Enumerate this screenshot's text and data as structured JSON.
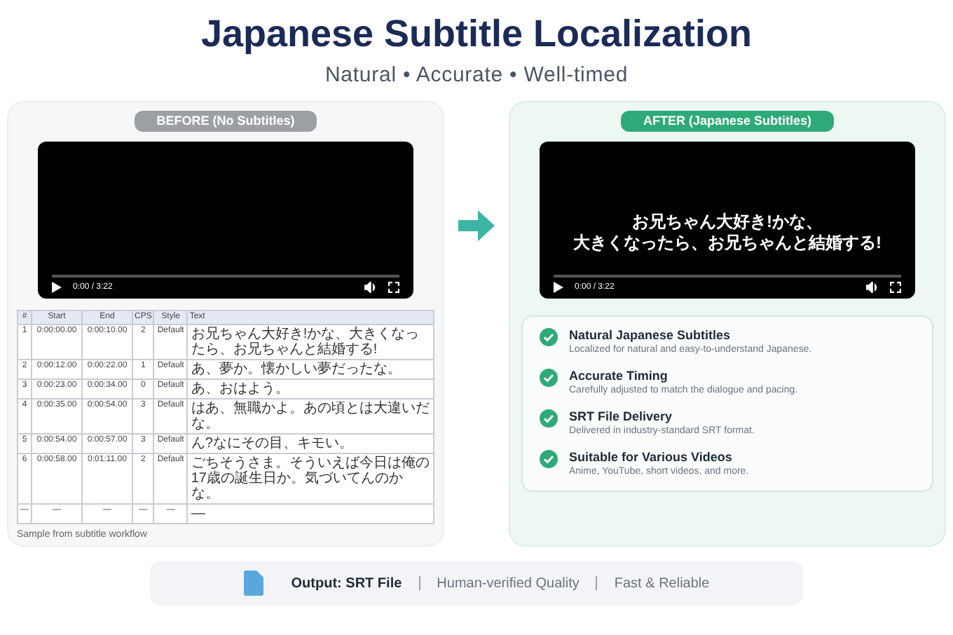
{
  "title": "Japanese Subtitle Localization",
  "subtitle": "Natural • Accurate • Well-timed",
  "before": {
    "label": "BEFORE (No Subtitles)",
    "video": {
      "time": "0:00 / 3:22"
    },
    "table": {
      "columns": [
        "#",
        "Start",
        "End",
        "CPS",
        "Style",
        "Text"
      ],
      "rows": [
        [
          "1",
          "0:00:00.00",
          "0:00:10.00",
          "2",
          "Default",
          "お兄ちゃん大好き!かな、大きくなったら、お兄ちゃんと結婚する!"
        ],
        [
          "2",
          "0:00:12.00",
          "0:00:22.00",
          "1",
          "Default",
          "あ、夢か。懐かしい夢だったな。"
        ],
        [
          "3",
          "0:00:23.00",
          "0:00:34.00",
          "0",
          "Default",
          "あ、おはよう。"
        ],
        [
          "4",
          "0:00:35.00",
          "0:00:54.00",
          "3",
          "Default",
          "はあ、無職かよ。あの頃とは大違いだな。"
        ],
        [
          "5",
          "0:00:54.00",
          "0:00:57.00",
          "3",
          "Default",
          "ん?なにその目、キモい。"
        ],
        [
          "6",
          "0:00:58.00",
          "0:01:11.00",
          "2",
          "Default",
          "ごちそうさま。そういえば今日は俺の17歳の誕生日か。気づいてんのかな。"
        ],
        [
          "—",
          "—",
          "—",
          "—",
          "—",
          "—"
        ]
      ]
    },
    "caption": "Sample from subtitle workflow"
  },
  "after": {
    "label": "AFTER (Japanese Subtitles)",
    "video": {
      "time": "0:00 / 3:22",
      "subtitle_lines": [
        "お兄ちゃん大好き!かな、",
        "大きくなったら、お兄ちゃんと結婚する!"
      ]
    },
    "features": [
      {
        "title": "Natural Japanese Subtitles",
        "description": "Localized for natural and easy-to-understand Japanese."
      },
      {
        "title": "Accurate Timing",
        "description": "Carefully adjusted to match the dialogue and pacing."
      },
      {
        "title": "SRT File Delivery",
        "description": "Delivered in industry-standard SRT format."
      },
      {
        "title": "Suitable for Various Videos",
        "description": "Anime, YouTube, short videos, and more."
      }
    ]
  },
  "footer": {
    "output": "Output: SRT File",
    "items": [
      "Human-verified Quality",
      "Fast & Reliable"
    ]
  }
}
